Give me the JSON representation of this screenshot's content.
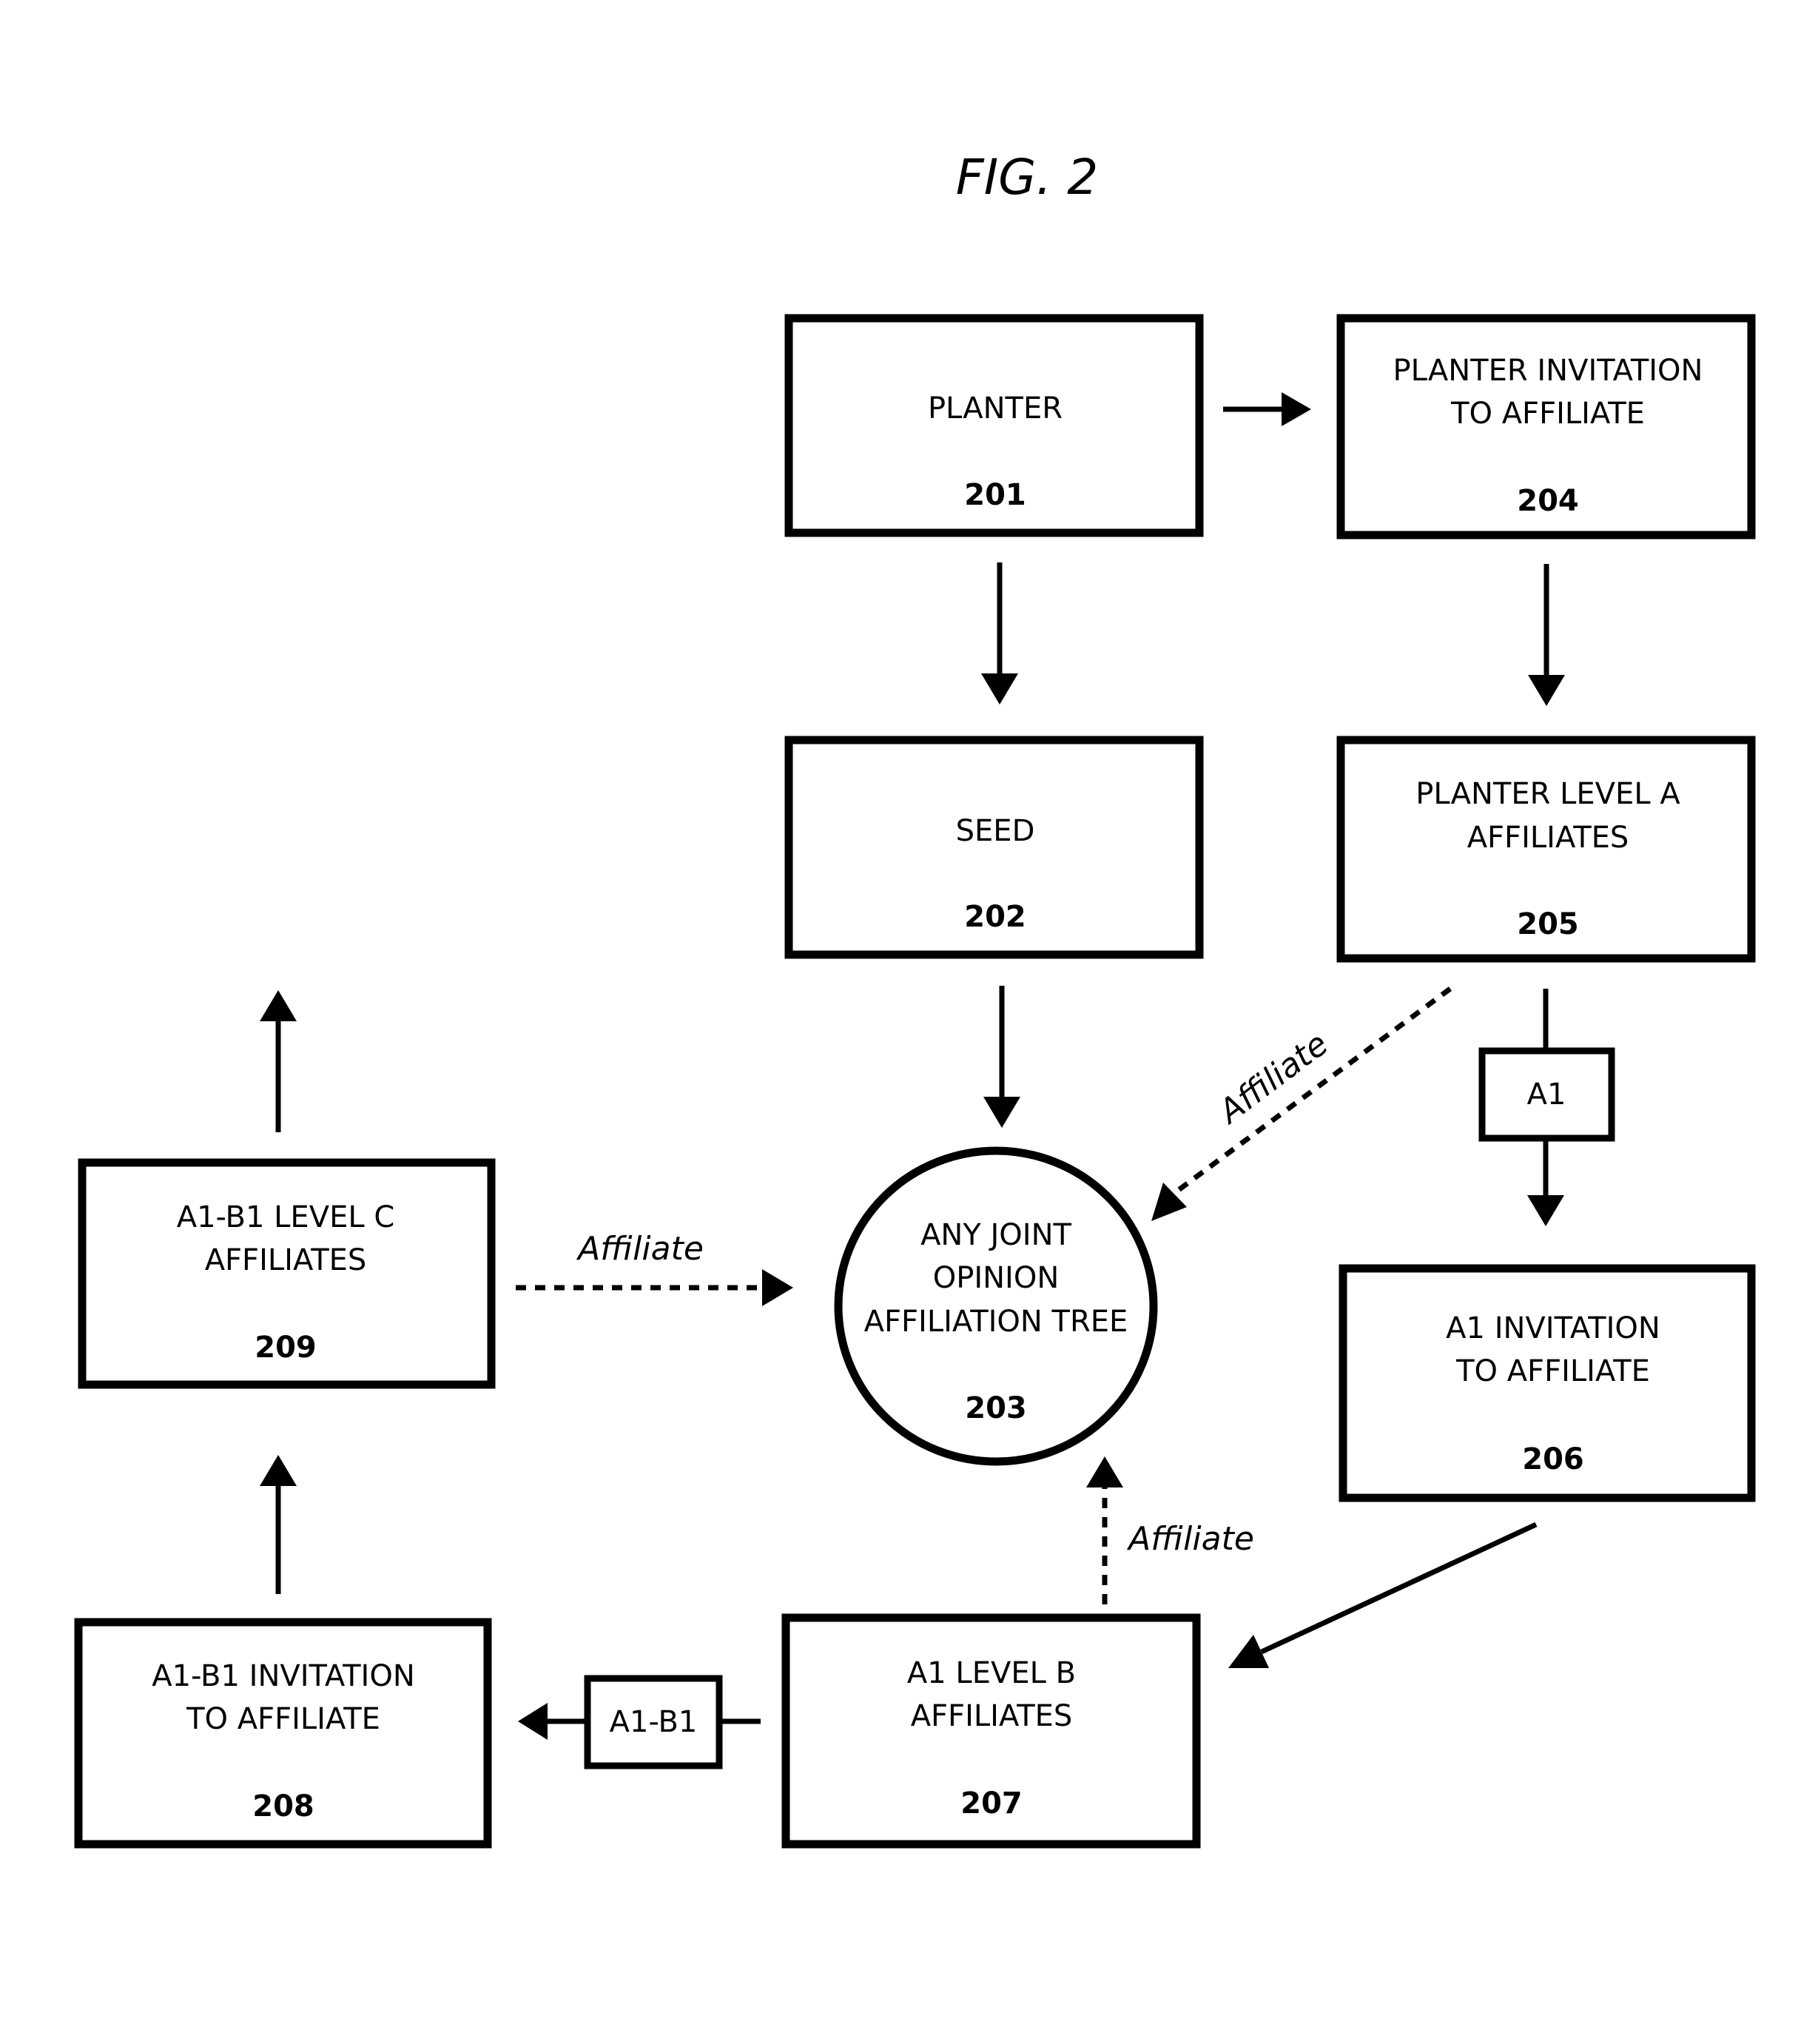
{
  "figure": {
    "title": "FIG. 2"
  },
  "nodes": {
    "n201": {
      "lines": [
        "PLANTER"
      ],
      "number": "201"
    },
    "n202": {
      "lines": [
        "SEED"
      ],
      "number": "202"
    },
    "n203": {
      "lines": [
        "ANY JOINT",
        "OPINION",
        "AFFILIATION TREE"
      ],
      "number": "203"
    },
    "n204": {
      "lines": [
        "PLANTER INVITATION",
        "TO AFFILIATE"
      ],
      "number": "204"
    },
    "n205": {
      "lines": [
        "PLANTER LEVEL A",
        "AFFILIATES"
      ],
      "number": "205"
    },
    "n206": {
      "lines": [
        "A1 INVITATION",
        "TO AFFILIATE"
      ],
      "number": "206"
    },
    "n207": {
      "lines": [
        "A1 LEVEL B",
        "AFFILIATES"
      ],
      "number": "207"
    },
    "n208": {
      "lines": [
        "A1-B1 INVITATION",
        "TO AFFILIATE"
      ],
      "number": "208"
    },
    "n209": {
      "lines": [
        "A1-B1 LEVEL C",
        "AFFILIATES"
      ],
      "number": "209"
    }
  },
  "connector_tags": {
    "a1": "A1",
    "a1b1": "A1-B1"
  },
  "edge_labels": {
    "from205": "Affiliate",
    "from209": "Affiliate",
    "from207": "Affiliate"
  },
  "edges": [
    {
      "from": "201",
      "to": "204",
      "style": "solid"
    },
    {
      "from": "201",
      "to": "202",
      "style": "solid"
    },
    {
      "from": "204",
      "to": "205",
      "style": "solid"
    },
    {
      "from": "202",
      "to": "203",
      "style": "solid"
    },
    {
      "from": "205",
      "to": "203",
      "style": "dotted",
      "label": "Affiliate"
    },
    {
      "from": "205",
      "to": "206",
      "style": "solid",
      "tag": "A1"
    },
    {
      "from": "206",
      "to": "207",
      "style": "solid"
    },
    {
      "from": "207",
      "to": "203",
      "style": "dotted",
      "label": "Affiliate"
    },
    {
      "from": "207",
      "to": "208",
      "style": "solid",
      "tag": "A1-B1"
    },
    {
      "from": "208",
      "to": "209",
      "style": "solid"
    },
    {
      "from": "209",
      "to": "203",
      "style": "dotted",
      "label": "Affiliate"
    },
    {
      "from": "209",
      "to": "continuation",
      "style": "solid"
    }
  ]
}
